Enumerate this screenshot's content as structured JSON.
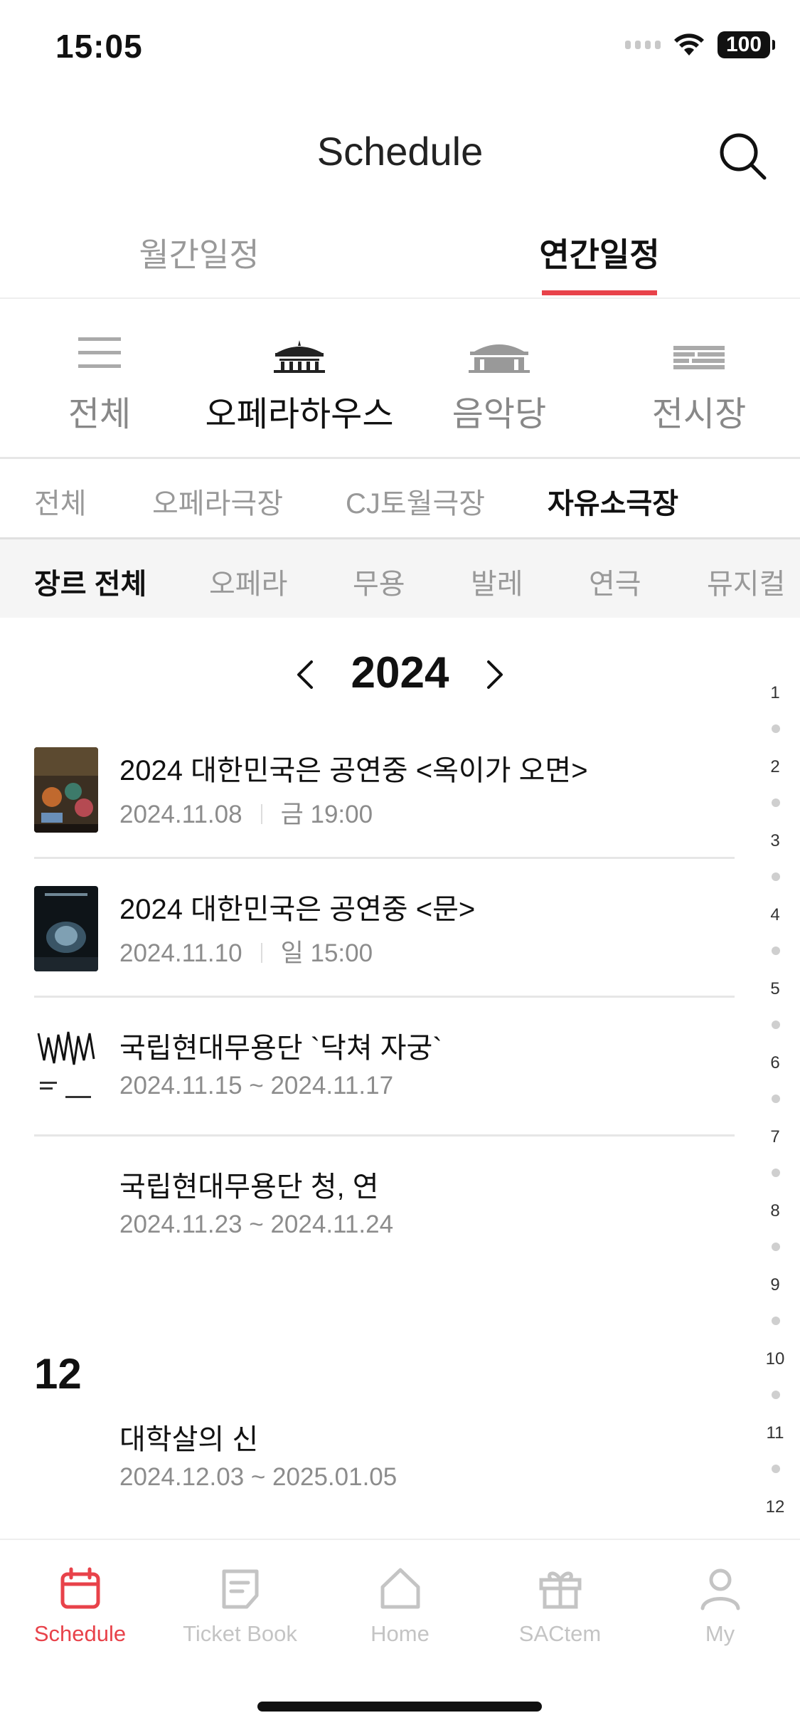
{
  "status_bar": {
    "time": "15:05",
    "battery": "100"
  },
  "header": {
    "title": "Schedule"
  },
  "tabs": [
    "월간일정",
    "연간일정"
  ],
  "venues": [
    {
      "label": "전체",
      "icon": "menu-icon"
    },
    {
      "label": "오페라하우스",
      "icon": "opera-house-icon"
    },
    {
      "label": "음악당",
      "icon": "concert-hall-icon"
    },
    {
      "label": "전시장",
      "icon": "exhibition-hall-icon"
    }
  ],
  "halls": [
    "전체",
    "오페라극장",
    "CJ토월극장",
    "자유소극장"
  ],
  "genres": [
    "장르 전체",
    "오페라",
    "무용",
    "발레",
    "연극",
    "뮤지컬"
  ],
  "year": "2024",
  "events": [
    {
      "title": "2024 대한민국은 공연중 <옥이가 오면>",
      "date": "2024.11.08",
      "time": "금 19:00"
    },
    {
      "title": "2024 대한민국은 공연중 <문>",
      "date": "2024.11.10",
      "time": "일 15:00"
    },
    {
      "title": "국립현대무용단 `닥쳐 자궁`",
      "date": "2024.11.15 ~ 2024.11.17"
    },
    {
      "title": "국립현대무용단 청, 연",
      "date": "2024.11.23 ~ 2024.11.24"
    }
  ],
  "month_header": "12",
  "december_events": [
    {
      "title": "대학살의 신",
      "date": "2024.12.03 ~ 2025.01.05"
    }
  ],
  "month_index": [
    "1",
    "2",
    "3",
    "4",
    "5",
    "6",
    "7",
    "8",
    "9",
    "10",
    "11",
    "12"
  ],
  "tab_bar": [
    {
      "label": "Schedule",
      "icon": "calendar-icon"
    },
    {
      "label": "Ticket Book",
      "icon": "ticket-book-icon"
    },
    {
      "label": "Home",
      "icon": "home-icon"
    },
    {
      "label": "SACtem",
      "icon": "gift-icon"
    },
    {
      "label": "My",
      "icon": "person-icon"
    }
  ],
  "colors": {
    "accent": "#e8424a",
    "inactive": "#999999"
  }
}
